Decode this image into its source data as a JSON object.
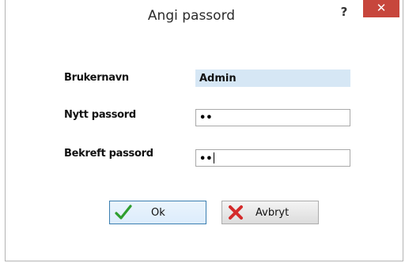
{
  "window": {
    "title": "Angi passord",
    "help_label": "?",
    "close_label": "✕"
  },
  "form": {
    "username": {
      "label": "Brukernavn",
      "value": "Admin"
    },
    "new_password": {
      "label": "Nytt passord",
      "value": "••"
    },
    "confirm_password": {
      "label": "Bekreft passord",
      "value": "••"
    }
  },
  "buttons": {
    "ok": {
      "label": "Ok",
      "icon": "checkmark-icon",
      "color": "#2e9e2e"
    },
    "cancel": {
      "label": "Avbryt",
      "icon": "red-x-icon",
      "color": "#d42a2a"
    }
  }
}
